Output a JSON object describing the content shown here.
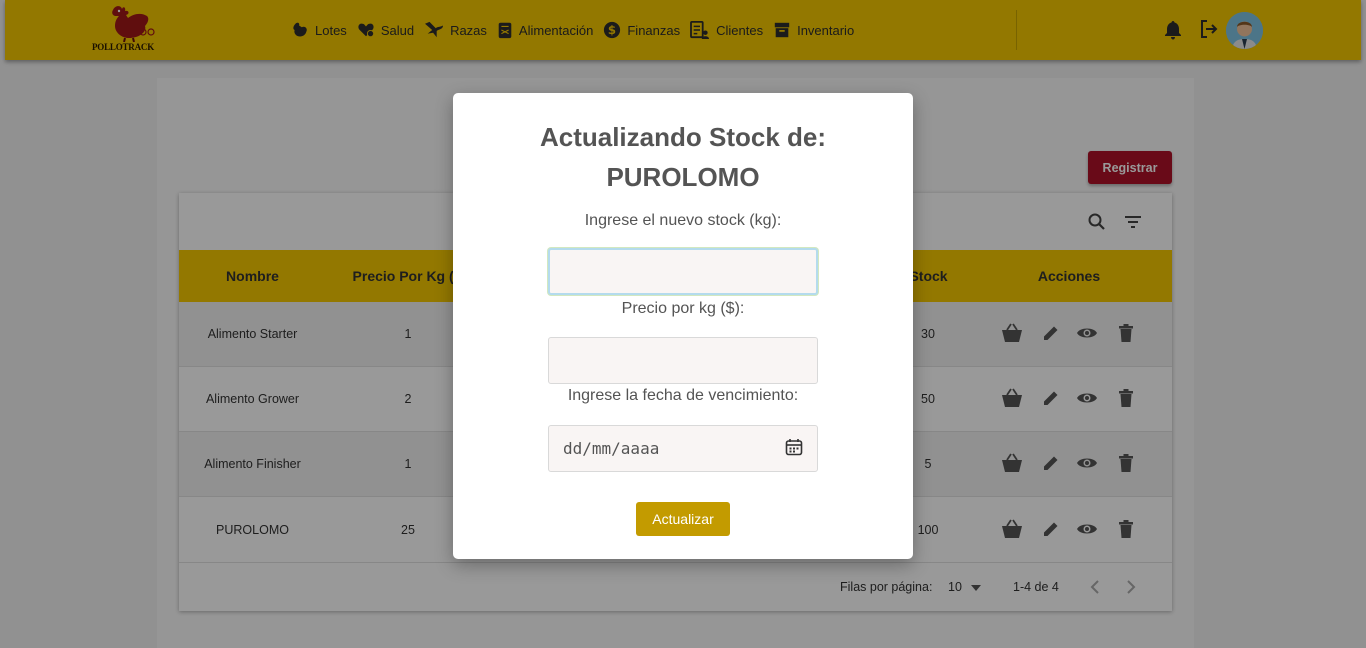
{
  "app": {
    "logo_text": "POLLOTRACK"
  },
  "nav": {
    "items": [
      {
        "label": "Lotes",
        "icon": "chicken-icon"
      },
      {
        "label": "Salud",
        "icon": "heart-health-icon"
      },
      {
        "label": "Razas",
        "icon": "bird-icon"
      },
      {
        "label": "Alimentación",
        "icon": "feed-bag-icon"
      },
      {
        "label": "Finanzas",
        "icon": "dollar-icon"
      },
      {
        "label": "Clientes",
        "icon": "clients-icon"
      },
      {
        "label": "Inventario",
        "icon": "inventory-icon"
      }
    ]
  },
  "header_icons": [
    "bell-icon",
    "logout-icon",
    "avatar"
  ],
  "page": {
    "register_label": "Registrar"
  },
  "table": {
    "columns": [
      "Nombre",
      "Precio Por Kg ($",
      "Stock",
      "Acciones"
    ],
    "rows": [
      {
        "name": "Alimento Starter",
        "price": "1",
        "stock": "30"
      },
      {
        "name": "Alimento Grower",
        "price": "2",
        "stock": "50"
      },
      {
        "name": "Alimento Finisher",
        "price": "1",
        "stock": "5"
      },
      {
        "name": "PUROLOMO",
        "price": "25",
        "stock": "100"
      }
    ],
    "row_actions": [
      "basket-icon",
      "edit-icon",
      "view-icon",
      "delete-icon"
    ],
    "footer": {
      "rows_per_page_label": "Filas por página:",
      "rows_per_page_value": "10",
      "range_text": "1-4 de 4"
    }
  },
  "modal": {
    "title_line1": "Actualizando Stock de:",
    "title_line2": "PUROLOMO",
    "stock_label": "Ingrese el nuevo stock (kg):",
    "price_label": "Precio por kg ($):",
    "date_label": "Ingrese la fecha de vencimiento:",
    "date_placeholder": "dd/mm/aaaa",
    "submit_label": "Actualizar"
  },
  "colors": {
    "navbar": "#f5c800",
    "register_button": "#b01228",
    "update_button": "#c39b00"
  }
}
